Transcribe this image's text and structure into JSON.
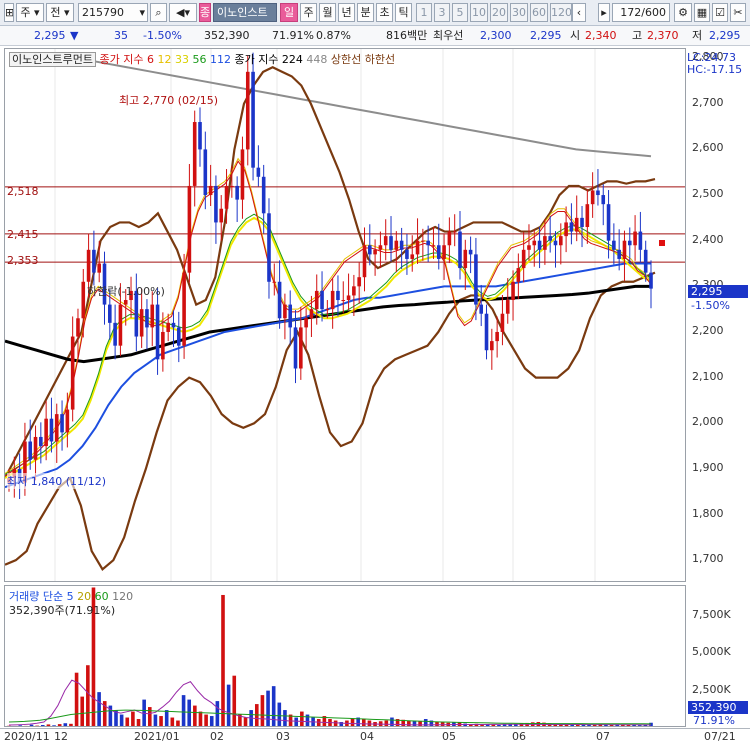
{
  "toolbar": {
    "type_label": "주",
    "side_label": "전",
    "code": "215790",
    "stock_name": "이노인스트",
    "period_day": "일",
    "period_week": "주",
    "period_month": "월",
    "period_year": "년",
    "period_minute": "분",
    "period_second": "초",
    "period_tick": "틱",
    "intervals": [
      "1",
      "3",
      "5",
      "10",
      "20",
      "30",
      "60",
      "120"
    ],
    "range": "172/600"
  },
  "quote": {
    "price": "2,295",
    "change": "35",
    "change_pct": "-1.50%",
    "volume": "352,390",
    "volume_pct": "71.91%",
    "turnover_pct": "0.87%",
    "amount": "816백만",
    "best_ask_label": "최우선",
    "best_ask": "2,300",
    "best_bid": "2,295",
    "open_label": "시",
    "open": "2,340",
    "high_label": "고",
    "high": "2,370",
    "low_label": "저",
    "low": "2,295"
  },
  "price_panel": {
    "title": "이노인스트루먼트",
    "ma_label": "종가 지수",
    "ma_periods": [
      "6",
      "12",
      "33",
      "56",
      "112"
    ],
    "long_label": "종가 지수 224",
    "long_value": "448",
    "upper_label": "상한선",
    "lower_label": "하한선",
    "high_mark": "최고 2,770 (02/15)",
    "low_mark": "최저 1,840 (11/12)",
    "limit_mark": "하한락(-1.00%)",
    "levels": [
      "2,518",
      "2,415",
      "2,353"
    ],
    "lc": "LC:24.73",
    "hc": "HC:-17.15",
    "current_price": "2,295",
    "current_pct": "-1.50%"
  },
  "volume_panel": {
    "title": "거래량",
    "ma_label": "단순",
    "ma_periods": [
      "5",
      "20",
      "60",
      "120"
    ],
    "current": "352,390주(71.91%)",
    "badge_value": "352,390",
    "badge_pct": "71.91%"
  },
  "colors": {
    "up": "#d11010",
    "down": "#1b35c8",
    "ma6": "#d11010",
    "ma12": "#e6c000",
    "ma33": "#f0e800",
    "ma56": "#1a9a1a",
    "ma112": "#1d4fe0",
    "ma224": "#000000",
    "envelope": "#7a3a10",
    "trend": "#8d8d8d",
    "level": "#a01010"
  },
  "icons": [
    "dropdown-arrow-icon",
    "search-icon",
    "speaker-icon",
    "chevron-left-icon",
    "chevron-right-icon",
    "grid-icon",
    "chart-settings-icon",
    "checkbox-icon",
    "scissors-icon"
  ],
  "x_labels": [
    "2020/11",
    "12",
    "2021/01",
    "02",
    "03",
    "04",
    "05",
    "06",
    "07",
    "07/21"
  ],
  "price_axis": [
    "2,800",
    "2,700",
    "2,600",
    "2,500",
    "2,400",
    "2,300",
    "2,200",
    "2,100",
    "2,000",
    "1,900",
    "1,800",
    "1,700"
  ],
  "volume_axis": [
    "7,500K",
    "5,000K",
    "2,500K"
  ],
  "chart_data": {
    "type": "candlestick",
    "title": "이노인스트루먼트",
    "ylim": [
      1650,
      2820
    ],
    "volume_ylim": [
      0,
      9500
    ],
    "x_start": "2020/11",
    "x_end": "07/21",
    "levels": [
      2518,
      2415,
      2353
    ],
    "closes": [
      1880,
      1900,
      1870,
      1960,
      1920,
      1970,
      1950,
      2010,
      1960,
      2020,
      1980,
      2030,
      2190,
      2230,
      2310,
      2380,
      2330,
      2350,
      2260,
      2220,
      2170,
      2260,
      2270,
      2290,
      2190,
      2250,
      2210,
      2260,
      2140,
      2200,
      2220,
      2210,
      2170,
      2330,
      2520,
      2660,
      2600,
      2500,
      2520,
      2440,
      2470,
      2520,
      2520,
      2490,
      2600,
      2770,
      2560,
      2540,
      2460,
      2310,
      2310,
      2230,
      2260,
      2210,
      2120,
      2210,
      2230,
      2250,
      2290,
      2250,
      2250,
      2290,
      2270,
      2270,
      2280,
      2300,
      2320,
      2390,
      2370,
      2380,
      2390,
      2410,
      2380,
      2400,
      2380,
      2360,
      2370,
      2400,
      2400,
      2390,
      2390,
      2360,
      2390,
      2420,
      2420,
      2340,
      2380,
      2370,
      2260,
      2240,
      2160,
      2180,
      2200,
      2240,
      2270,
      2310,
      2340,
      2380,
      2390,
      2400,
      2380,
      2410,
      2400,
      2390,
      2410,
      2440,
      2420,
      2450,
      2430,
      2480,
      2510,
      2500,
      2480,
      2400,
      2380,
      2360,
      2400,
      2390,
      2420,
      2380,
      2330,
      2295
    ],
    "ma6": [
      1890,
      1900,
      1910,
      1920,
      1930,
      1945,
      1960,
      1980,
      2000,
      2030,
      2080,
      2150,
      2230,
      2280,
      2300,
      2290,
      2280,
      2270,
      2260,
      2250,
      2240,
      2230,
      2220,
      2220,
      2230,
      2240,
      2280,
      2350,
      2420,
      2470,
      2500,
      2510,
      2520,
      2530,
      2550,
      2580,
      2560,
      2510,
      2450,
      2390,
      2330,
      2290,
      2260,
      2250,
      2250,
      2260,
      2270,
      2280,
      2300,
      2320,
      2340,
      2360,
      2370,
      2380,
      2390,
      2390,
      2385,
      2380,
      2380,
      2385,
      2390,
      2390,
      2395,
      2400,
      2395,
      2380,
      2360,
      2300,
      2240,
      2220,
      2230,
      2260,
      2290,
      2320,
      2350,
      2370,
      2390,
      2395,
      2400,
      2410,
      2420,
      2440,
      2460,
      2470,
      2470,
      2450,
      2430,
      2410,
      2400,
      2395,
      2390,
      2385,
      2380,
      2370,
      2360,
      2340,
      2330,
      2310
    ],
    "ma12": [
      1880,
      1890,
      1900,
      1910,
      1920,
      1930,
      1945,
      1960,
      1975,
      1990,
      2010,
      2050,
      2100,
      2160,
      2200,
      2220,
      2230,
      2230,
      2225,
      2220,
      2215,
      2210,
      2205,
      2200,
      2205,
      2215,
      2240,
      2290,
      2340,
      2390,
      2420,
      2440,
      2450,
      2440,
      2420,
      2380,
      2340,
      2300,
      2270,
      2250,
      2240,
      2230,
      2230,
      2235,
      2240,
      2250,
      2260,
      2270,
      2285,
      2300,
      2320,
      2335,
      2345,
      2355,
      2360,
      2365,
      2365,
      2360,
      2350,
      2330,
      2300,
      2280,
      2270,
      2275,
      2290,
      2310,
      2330,
      2350,
      2365,
      2380,
      2395,
      2410,
      2420,
      2425,
      2420,
      2410,
      2400,
      2390,
      2380,
      2365,
      2350,
      2335,
      2320,
      2310
    ],
    "ma112": [
      1860,
      1870,
      1880,
      1890,
      1900,
      1920,
      1950,
      1990,
      2040,
      2080,
      2110,
      2130,
      2150,
      2160,
      2170,
      2180,
      2190,
      2200,
      2205,
      2210,
      2215,
      2220,
      2225,
      2230,
      2240,
      2250,
      2260,
      2270,
      2275,
      2275,
      2280,
      2285,
      2290,
      2295,
      2300,
      2300,
      2300,
      2300,
      2300,
      2305,
      2310,
      2315,
      2320,
      2325,
      2330,
      2335,
      2340,
      2345,
      2350,
      2350,
      2350
    ],
    "ma224": [
      2180,
      2170,
      2160,
      2150,
      2140,
      2135,
      2140,
      2145,
      2150,
      2160,
      2170,
      2180,
      2190,
      2200,
      2205,
      2210,
      2215,
      2220,
      2225,
      2230,
      2235,
      2240,
      2245,
      2250,
      2255,
      2258,
      2260,
      2263,
      2265,
      2268,
      2270,
      2272,
      2274,
      2276,
      2278,
      2280,
      2282,
      2285,
      2290,
      2295,
      2300,
      2300
    ],
    "trend": [
      2800,
      2790,
      2780,
      2770,
      2760,
      2750,
      2740,
      2730,
      2720,
      2710,
      2700,
      2690,
      2680,
      2670,
      2660,
      2650,
      2640,
      2630,
      2620,
      2610,
      2600,
      2595,
      2590,
      2585
    ],
    "upper": [
      1880,
      1920,
      1960,
      2000,
      2040,
      2080,
      2120,
      2160,
      2200,
      2300,
      2400,
      2430,
      2440,
      2440,
      2430,
      2440,
      2460,
      2420,
      2380,
      2320,
      2260,
      2270,
      2320,
      2440,
      2600,
      2700,
      2740,
      2770,
      2780,
      2770,
      2760,
      2740,
      2700,
      2650,
      2600,
      2550,
      2490,
      2420,
      2360,
      2340,
      2350,
      2360,
      2380,
      2400,
      2420,
      2430,
      2420,
      2420,
      2430,
      2440,
      2440,
      2440,
      2440,
      2430,
      2420,
      2420,
      2430,
      2460,
      2500,
      2520,
      2520,
      2510,
      2520,
      2530,
      2530,
      2525,
      2530,
      2530,
      2535
    ],
    "lower": [
      1690,
      1700,
      1720,
      1780,
      1820,
      1860,
      1880,
      1820,
      1720,
      1680,
      1700,
      1750,
      1830,
      1900,
      1980,
      2050,
      2080,
      2100,
      2090,
      2060,
      2020,
      2000,
      1990,
      2000,
      2020,
      2080,
      2160,
      2200,
      2150,
      2060,
      1980,
      1950,
      1960,
      2000,
      2080,
      2120,
      2140,
      2150,
      2160,
      2170,
      2200,
      2240,
      2270,
      2280,
      2280,
      2250,
      2200,
      2160,
      2120,
      2100,
      2100,
      2100,
      2120,
      2160,
      2230,
      2280,
      2300,
      2310,
      2310,
      2320,
      2330
    ],
    "volumes": [
      150,
      120,
      180,
      140,
      220,
      160,
      200,
      240,
      180,
      260,
      320,
      280,
      3700,
      2100,
      4200,
      9400,
      2400,
      1800,
      1500,
      1200,
      900,
      700,
      1100,
      600,
      1900,
      1400,
      900,
      800,
      1200,
      700,
      500,
      2200,
      1900,
      1500,
      1100,
      900,
      800,
      1800,
      8900,
      2900,
      3500,
      900,
      700,
      1200,
      1600,
      2200,
      2500,
      2800,
      1700,
      1200,
      900,
      700,
      1100,
      900,
      700,
      600,
      800,
      600,
      500,
      400,
      500,
      650,
      700,
      600,
      500,
      400,
      450,
      500,
      700,
      600,
      550,
      500,
      480,
      450,
      600,
      500,
      420,
      380,
      350,
      400,
      380,
      300,
      260,
      280,
      240,
      260,
      220,
      200,
      230,
      240,
      260,
      300,
      340,
      380,
      400,
      360,
      320,
      300,
      280,
      260,
      300,
      280,
      240,
      260,
      220,
      280,
      240,
      220,
      250,
      240,
      230,
      200,
      190,
      210,
      352
    ],
    "volume_ma5": [
      200,
      210,
      230,
      260,
      320,
      400,
      800,
      1500,
      2500,
      3200,
      3000,
      2500,
      2000,
      1700,
      1400,
      1100,
      1000,
      1100,
      1200,
      1000,
      950,
      1050,
      1400,
      1800,
      2400,
      2900,
      3100,
      2500,
      2000,
      1700,
      1300,
      1100,
      950,
      800,
      700,
      650,
      620,
      600,
      560,
      520,
      480,
      460,
      440,
      420,
      400,
      380,
      360,
      340,
      320,
      300,
      290,
      280,
      270,
      260,
      250,
      240,
      230,
      220,
      210,
      210,
      210,
      215,
      220,
      225,
      230,
      232,
      234,
      236,
      238,
      240,
      245,
      250,
      252,
      250,
      248,
      245,
      240,
      238,
      236,
      234,
      232,
      230,
      230,
      228,
      226,
      224,
      222,
      220,
      218,
      216,
      214,
      212,
      210
    ],
    "volume_ma20": [
      400,
      420,
      440,
      480,
      520,
      600,
      700,
      800,
      900,
      950,
      1000,
      1050,
      1100,
      1150,
      1180,
      1200,
      1190,
      1180,
      1160,
      1140,
      1120,
      1100,
      1080,
      1060,
      1040,
      1020,
      1000,
      980,
      960,
      940,
      920,
      900,
      880,
      860,
      840,
      820,
      800,
      780,
      760,
      740,
      720,
      700,
      680,
      660,
      640,
      620,
      600,
      580,
      560,
      540,
      520,
      500,
      480,
      460,
      440,
      420,
      400,
      390,
      380,
      370,
      360,
      350,
      340,
      330,
      320,
      315,
      310,
      305,
      300,
      298,
      296,
      294,
      292,
      290,
      289,
      288,
      287,
      286,
      285,
      284,
      283,
      282,
      281,
      280
    ]
  }
}
